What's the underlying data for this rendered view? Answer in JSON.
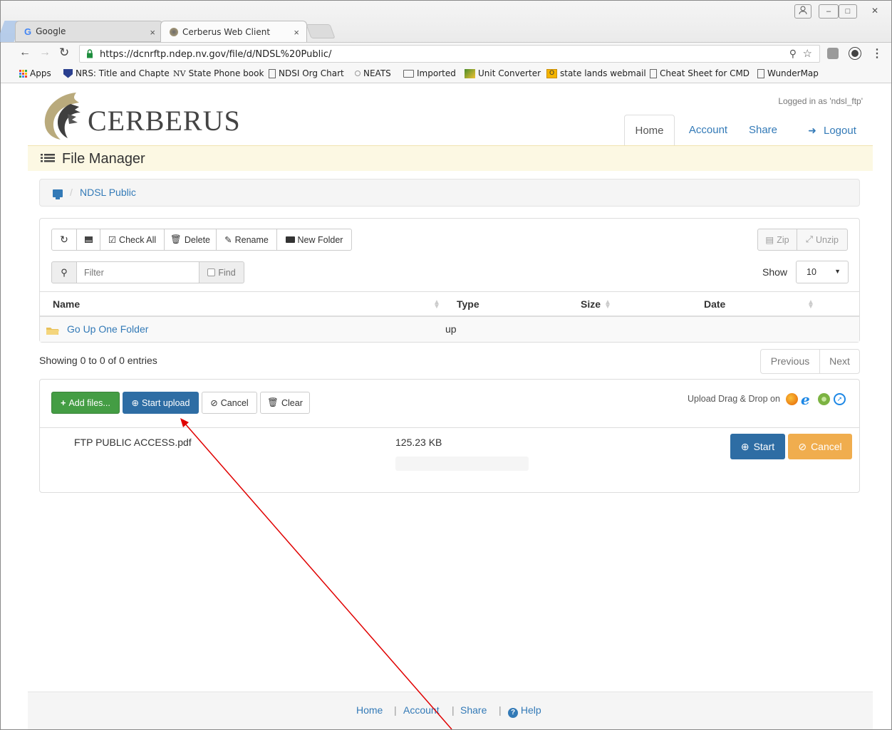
{
  "browser": {
    "tabs": [
      {
        "title": "Google",
        "close": "×"
      },
      {
        "title": "Cerberus Web Client",
        "close": "×"
      }
    ],
    "url": "https://dcnrftp.ndep.nv.gov/file/d/NDSL%20Public/",
    "window_buttons": [
      "–",
      "□",
      "✕"
    ],
    "bookmarks": [
      {
        "label": "Apps",
        "icon": "apps-grid-icon"
      },
      {
        "label": "NRS: Title and Chapte",
        "icon": "shield-icon"
      },
      {
        "label": "State Phone book",
        "icon": "nv-icon",
        "prefix": "NV"
      },
      {
        "label": "NDSI Org Chart",
        "icon": "page-icon"
      },
      {
        "label": "NEATS",
        "icon": "dot-icon"
      },
      {
        "label": "Imported",
        "icon": "folder-icon"
      },
      {
        "label": "Unit Converter",
        "icon": "converter-icon"
      },
      {
        "label": "state lands webmail",
        "icon": "outlook-icon"
      },
      {
        "label": "Cheat Sheet for CMD",
        "icon": "page-icon"
      },
      {
        "label": "WunderMap",
        "icon": "page-icon"
      }
    ]
  },
  "site": {
    "logo": "CERBERUS",
    "logged_in": "Logged in as 'ndsl_ftp'",
    "nav": {
      "home": "Home",
      "account": "Account",
      "share": "Share",
      "logout": "Logout"
    },
    "page_title": "File Manager"
  },
  "breadcrumb": {
    "folder": "NDSL Public",
    "sep": "/"
  },
  "toolbar": {
    "check_all": "Check All",
    "delete": "Delete",
    "rename": "Rename",
    "new_folder": "New Folder",
    "zip": "Zip",
    "unzip": "Unzip",
    "filter_placeholder": "Filter",
    "find": "Find",
    "show_label": "Show",
    "show_value": "10"
  },
  "table": {
    "headers": {
      "name": "Name",
      "type": "Type",
      "size": "Size",
      "date": "Date"
    },
    "rows": [
      {
        "name": "Go Up One Folder",
        "type": "up"
      }
    ],
    "info": "Showing 0 to 0 of 0 entries",
    "prev": "Previous",
    "next": "Next"
  },
  "upload": {
    "add_files": "Add files...",
    "start_upload": "Start upload",
    "cancel": "Cancel",
    "clear": "Clear",
    "drag_drop": "Upload Drag & Drop on",
    "file": {
      "name": "FTP PUBLIC ACCESS.pdf",
      "size": "125.23 KB",
      "progress": 0
    },
    "start": "Start",
    "file_cancel": "Cancel"
  },
  "footer": {
    "home": "Home",
    "account": "Account",
    "share": "Share",
    "help": "Help"
  },
  "colors": {
    "link": "#337ab7",
    "success": "#449d44",
    "primary": "#2e6da4",
    "warning": "#f0ad4e",
    "title_bar": "#fcf8e3",
    "annotation": "#e00000"
  }
}
